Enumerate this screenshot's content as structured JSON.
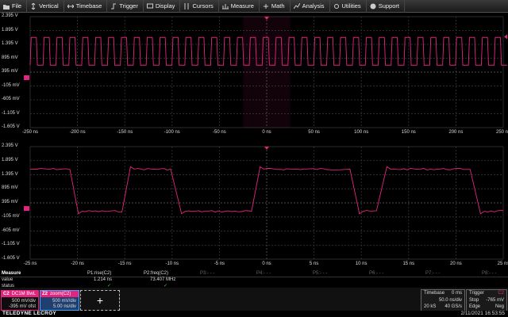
{
  "menu": [
    {
      "label": "File",
      "icon": "folder-icon"
    },
    {
      "label": "Vertical",
      "icon": "vertical-icon"
    },
    {
      "label": "Timebase",
      "icon": "timebase-icon"
    },
    {
      "label": "Trigger",
      "icon": "trigger-icon"
    },
    {
      "label": "Display",
      "icon": "display-icon"
    },
    {
      "label": "Cursors",
      "icon": "cursors-icon"
    },
    {
      "label": "Measure",
      "icon": "measure-icon"
    },
    {
      "label": "Math",
      "icon": "math-icon"
    },
    {
      "label": "Analysis",
      "icon": "analysis-icon"
    },
    {
      "label": "Utilities",
      "icon": "utilities-icon"
    },
    {
      "label": "Support",
      "icon": "support-icon"
    }
  ],
  "colors": {
    "trace": "#e4257f",
    "grid": "#3a3a3a",
    "accent": "#1e90ff"
  },
  "top_grid": {
    "y_labels": [
      "2.395 V",
      "1.895 V",
      "1.395 V",
      "895 mV",
      "395 mV",
      "-105 mV",
      "-605 mV",
      "-1.105 V",
      "-1.605 V"
    ],
    "x_labels": [
      "-250 ns",
      "-200 ns",
      "-150 ns",
      "-100 ns",
      "-50 ns",
      "0 ns",
      "50 ns",
      "100 ns",
      "150 ns",
      "200 ns",
      "250 ns"
    ]
  },
  "bottom_grid": {
    "y_labels": [
      "2.395 V",
      "1.895 V",
      "1.395 V",
      "895 mV",
      "395 mV",
      "-105 mV",
      "-605 mV",
      "-1.105 V",
      "-1.605 V"
    ],
    "x_labels": [
      "-25 ns",
      "-20 ns",
      "-15 ns",
      "-10 ns",
      "-5 ns",
      "0 ns",
      "5 ns",
      "10 ns",
      "15 ns",
      "20 ns",
      "25 ns"
    ]
  },
  "measure": {
    "row_labels": [
      "Measure",
      "value",
      "status"
    ],
    "params": [
      {
        "name": "P1:rise(C2)",
        "value": "1.214 ns",
        "status": "✓",
        "dim": false
      },
      {
        "name": "P2:freq(C2)",
        "value": "73.407 MHz",
        "status": "✓",
        "dim": false
      },
      {
        "name": "P3:- - -",
        "value": "",
        "status": "",
        "dim": true
      },
      {
        "name": "P4:- - -",
        "value": "",
        "status": "",
        "dim": true
      },
      {
        "name": "P5:- - -",
        "value": "",
        "status": "",
        "dim": true
      },
      {
        "name": "P6:- - -",
        "value": "",
        "status": "",
        "dim": true
      },
      {
        "name": "P7:- - -",
        "value": "",
        "status": "",
        "dim": true
      },
      {
        "name": "P8:- - -",
        "value": "",
        "status": "",
        "dim": true
      }
    ]
  },
  "channel": {
    "name": "C2",
    "tags": "DC1M BwL",
    "vdiv": "500 mV/div",
    "offset": "-395 mV ofst"
  },
  "zoom": {
    "name": "Z2",
    "tag": "zoom(C2)",
    "vdiv": "500 mV/div",
    "tdiv": "5.00 ns/div"
  },
  "timebase": {
    "title": "Timebase",
    "delay": "0 ms",
    "tdiv": "50.0 ns/div",
    "samples": "20 kS",
    "rate": "40 GS/s"
  },
  "trigger": {
    "title": "Trigger",
    "ch": "C2",
    "mode": "Stop",
    "level": "-765 mV",
    "type": "Edge",
    "slope": "Neg"
  },
  "brand": "TELEDYNE LECROY",
  "datetime": "2/11/2021 16:53:55"
}
